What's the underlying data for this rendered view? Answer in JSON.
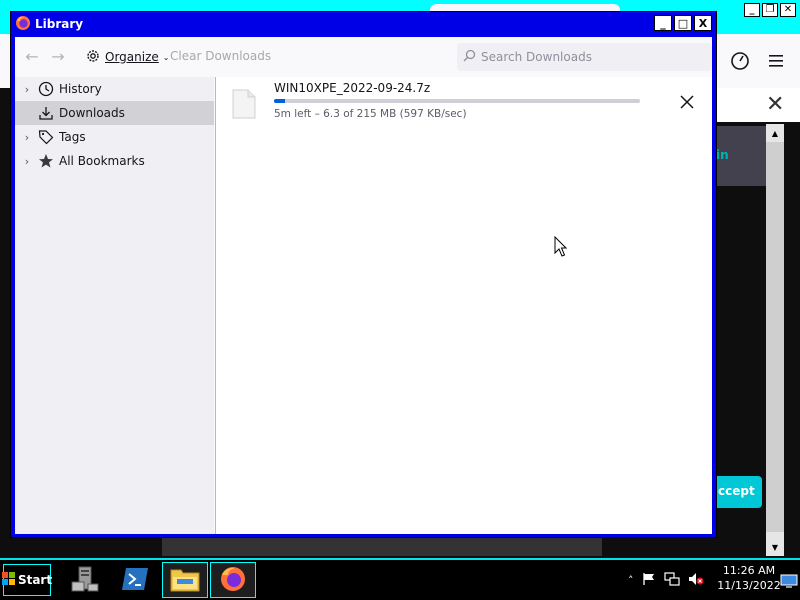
{
  "window": {
    "title": "Library",
    "minimize_symbol": "_",
    "maximize_symbol": "□",
    "close_symbol": "X"
  },
  "toolbar": {
    "back_symbol": "←",
    "forward_symbol": "→",
    "organize_label": "Organize",
    "clear_downloads_label": "Clear Downloads",
    "search_placeholder": "Search Downloads"
  },
  "sidebar": {
    "items": [
      {
        "label": "History",
        "icon": "clock-icon",
        "expandable": true,
        "selected": false
      },
      {
        "label": "Downloads",
        "icon": "download-icon",
        "expandable": false,
        "selected": true
      },
      {
        "label": "Tags",
        "icon": "tag-icon",
        "expandable": true,
        "selected": false
      },
      {
        "label": "All Bookmarks",
        "icon": "star-icon",
        "expandable": true,
        "selected": false
      }
    ]
  },
  "downloads": [
    {
      "filename": "WIN10XPE_2022-09-24.7z",
      "status": "5m left – 6.3 of 215 MB (597 KB/sec)",
      "progress": 0.029
    }
  ],
  "background": {
    "page_text": "in",
    "accept_label": "ccept"
  },
  "taskbar": {
    "start_label": "Start",
    "time": "11:26 AM",
    "date": "11/13/2022",
    "apps": [
      "server-manager-icon",
      "powershell-icon",
      "file-explorer-icon",
      "firefox-icon"
    ]
  },
  "colors": {
    "titlebar": "#0000e6",
    "accent_cyan": "#00ffff",
    "progress": "#0060df"
  }
}
